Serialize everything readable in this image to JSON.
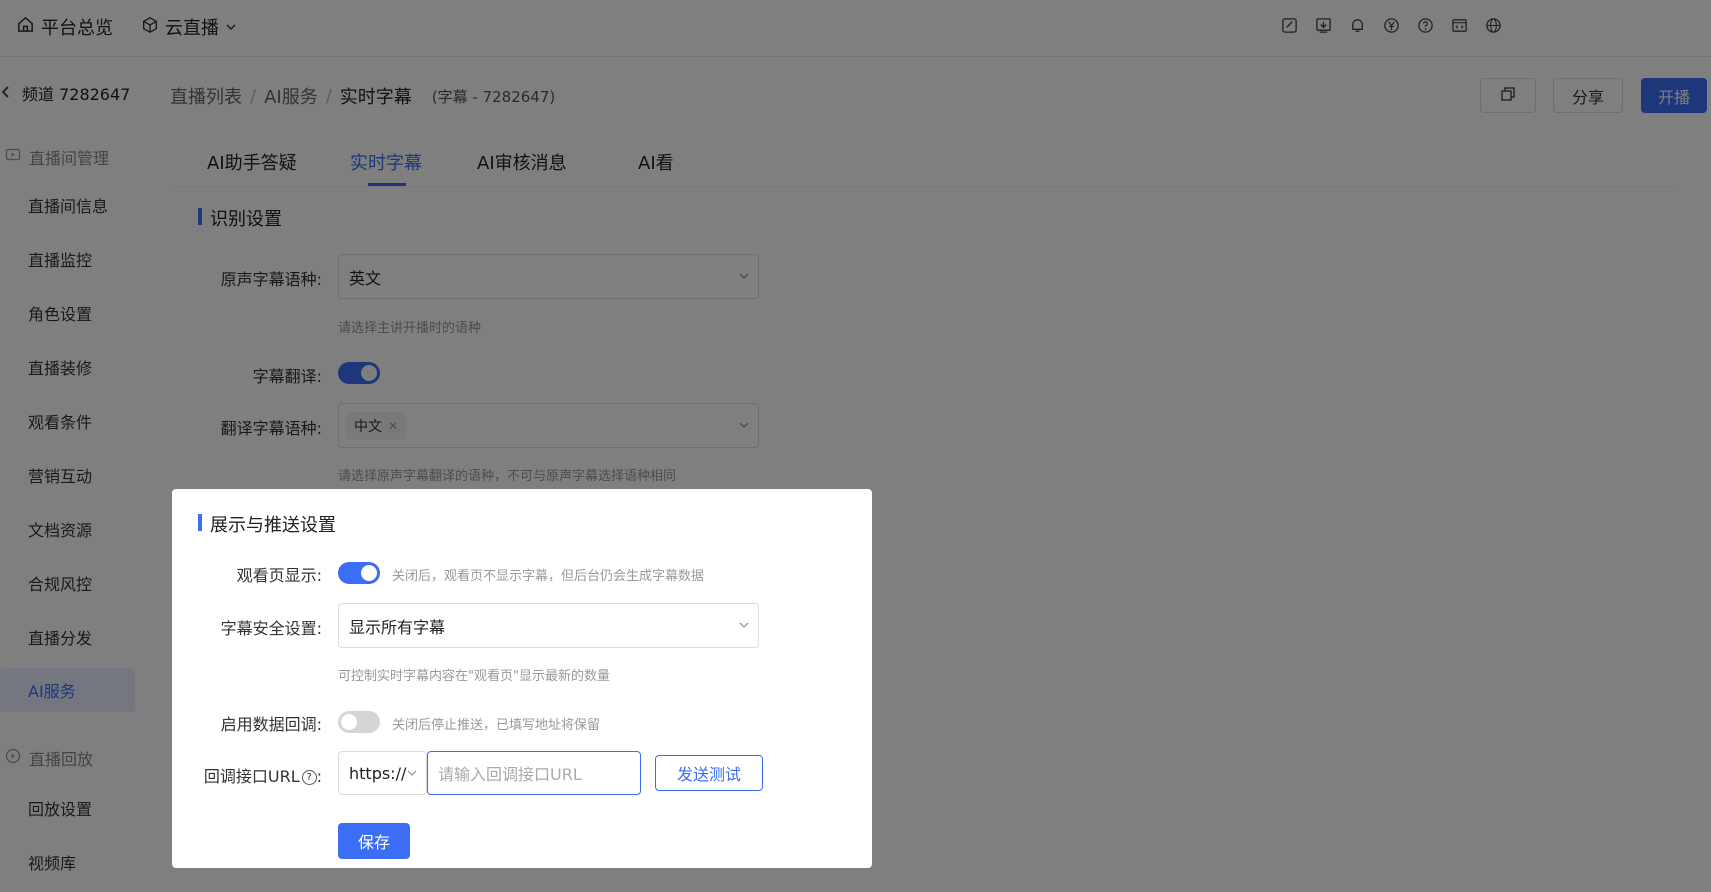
{
  "topbar": {
    "home_label": "平台总览",
    "product_label": "云直播",
    "icons": [
      "edit-icon",
      "download-icon",
      "bell-icon",
      "yen-icon",
      "help-icon",
      "code-window-icon",
      "globe-icon"
    ]
  },
  "header": {
    "channel": "频道 7282647",
    "crumbs": [
      "直播列表",
      "AI服务",
      "实时字幕"
    ],
    "crumb_sep": "/",
    "crumb_sub": "(字幕 - 7282647)",
    "share_label": "分享",
    "start_label": "开播"
  },
  "sidebar": {
    "group1": "直播间管理",
    "items": [
      "直播间信息",
      "直播监控",
      "角色设置",
      "直播装修",
      "观看条件",
      "营销互动",
      "文档资源",
      "合规风控",
      "直播分发",
      "AI服务"
    ],
    "active_index": 9,
    "group2": "直播回放",
    "items2": [
      "回放设置",
      "视频库"
    ]
  },
  "tabs": [
    "AI助手答疑",
    "实时字幕",
    "AI审核消息",
    "AI看"
  ],
  "active_tab": 1,
  "recognition": {
    "title": "识别设置",
    "source_lang_label": "原声字幕语种:",
    "source_lang_value": "英文",
    "source_lang_hint": "请选择主讲开播时的语种",
    "translate_label": "字幕翻译:",
    "translate_on": true,
    "target_lang_label": "翻译字幕语种:",
    "target_lang_tag": "中文",
    "target_lang_hint": "请选择原声字幕翻译的语种，不可与原声字幕选择语种相同"
  },
  "display": {
    "title": "展示与推送设置",
    "viewer_label": "观看页显示:",
    "viewer_on": true,
    "viewer_hint": "关闭后，观看页不显示字幕，但后台仍会生成字幕数据",
    "safety_label": "字幕安全设置:",
    "safety_value": "显示所有字幕",
    "safety_hint": "可控制实时字幕内容在\"观看页\"显示最新的数量",
    "callback_label": "启用数据回调:",
    "callback_on": false,
    "callback_hint": "关闭后停止推送，已填写地址将保留",
    "url_label": "回调接口URL",
    "url_colon": ":",
    "protocol": "https://",
    "url_placeholder": "请输入回调接口URL",
    "test_label": "发送测试",
    "save_label": "保存"
  },
  "colors": {
    "primary": "#3b6ef5",
    "overlay": "rgba(0,0,0,0.5)"
  }
}
